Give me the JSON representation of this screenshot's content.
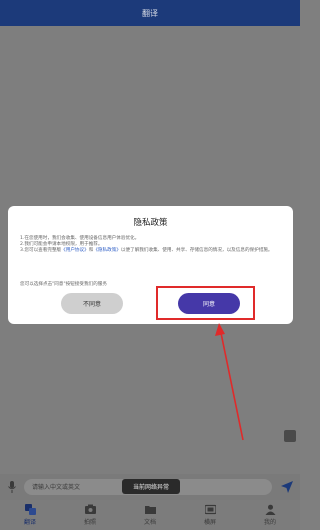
{
  "header": {
    "title": "翻译"
  },
  "input_bar": {
    "placeholder": "请输入中文或英文"
  },
  "toast": {
    "text": "当前网络异常"
  },
  "nav": {
    "items": [
      {
        "label": "翻译",
        "icon": "translate-icon",
        "active": true
      },
      {
        "label": "拍照",
        "icon": "camera-icon",
        "active": false
      },
      {
        "label": "文档",
        "icon": "folder-icon",
        "active": false
      },
      {
        "label": "横屏",
        "icon": "landscape-icon",
        "active": false
      },
      {
        "label": "我的",
        "icon": "user-icon",
        "active": false
      }
    ]
  },
  "dialog": {
    "title": "隐私政策",
    "line1": "1.在您使用时，我们会收集、使用设备信息用户体验优化。",
    "line2": "2.我们可能会申请本地权限，用于推荐。",
    "line3_prefix": "3.您可以查看完整版",
    "link1": "《用户协议》",
    "line3_mid": "和",
    "link2": "《隐私政策》",
    "line3_suffix": "以便了解我们收集、使用、共享、存储信息的情况，以及信息的保护措施。",
    "note": "您可以选择点击\"同意\"按钮接受我们的服务",
    "disagree_label": "不同意",
    "agree_label": "同意"
  },
  "colors": {
    "header_bg": "#1c3a7a",
    "agree_button": "#4538a8",
    "highlight": "#e02a2a",
    "link": "#2c5cc5"
  }
}
